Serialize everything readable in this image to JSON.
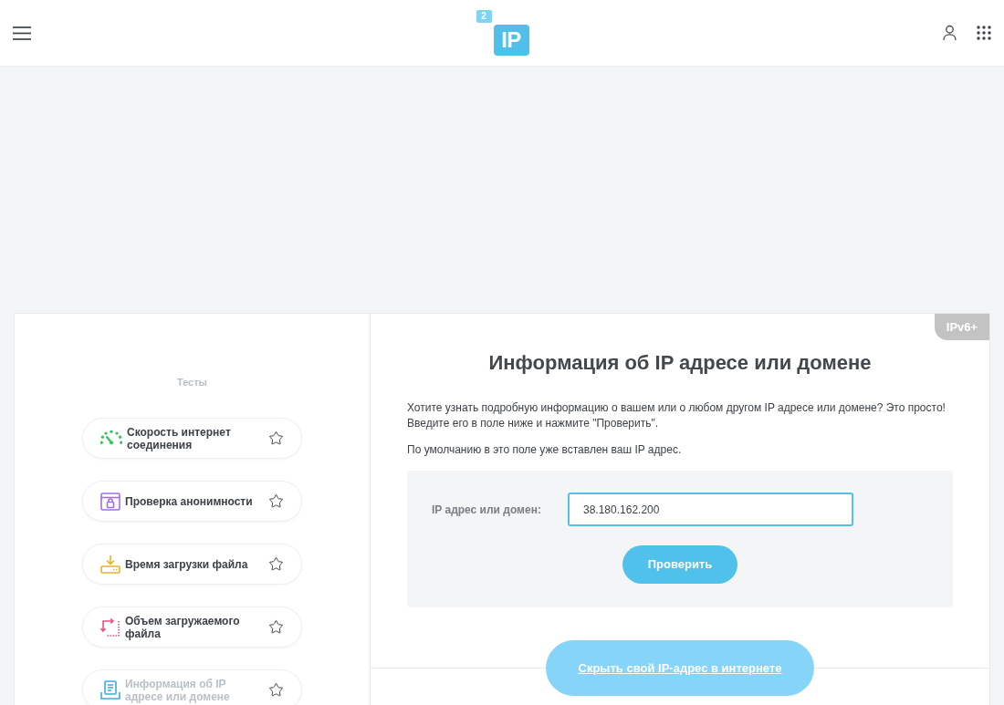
{
  "header": {
    "logo": {
      "small_tile": "2",
      "main_tile": "IP"
    }
  },
  "sidebar": {
    "title": "Тесты",
    "items": [
      {
        "label": "Скорость интернет соединения",
        "selected": false
      },
      {
        "label": "Проверка анонимности",
        "selected": false
      },
      {
        "label": "Время загрузки файла",
        "selected": false
      },
      {
        "label": "Объем загружаемого файла",
        "selected": false
      },
      {
        "label": "Информация об IP адресе или домене",
        "selected": true
      }
    ]
  },
  "main": {
    "badge": "IPv6+",
    "title": "Информация об IP адресе или домене",
    "paragraphs": [
      {
        "lines": [
          "Хотите узнать подробную информацию о вашем или о любом другом IP адресе или домене? Это просто!",
          "Введите его в поле ниже и нажмите \"Проверить\"."
        ]
      },
      {
        "lines": [
          "По умолчанию в это поле уже вставлен ваш IP адрес."
        ]
      }
    ],
    "form": {
      "label": "IP адрес или домен:",
      "value": "38.180.162.200",
      "button": "Проверить"
    },
    "hide_ip_button": "Скрыть свой IP-адрес в интернете"
  }
}
